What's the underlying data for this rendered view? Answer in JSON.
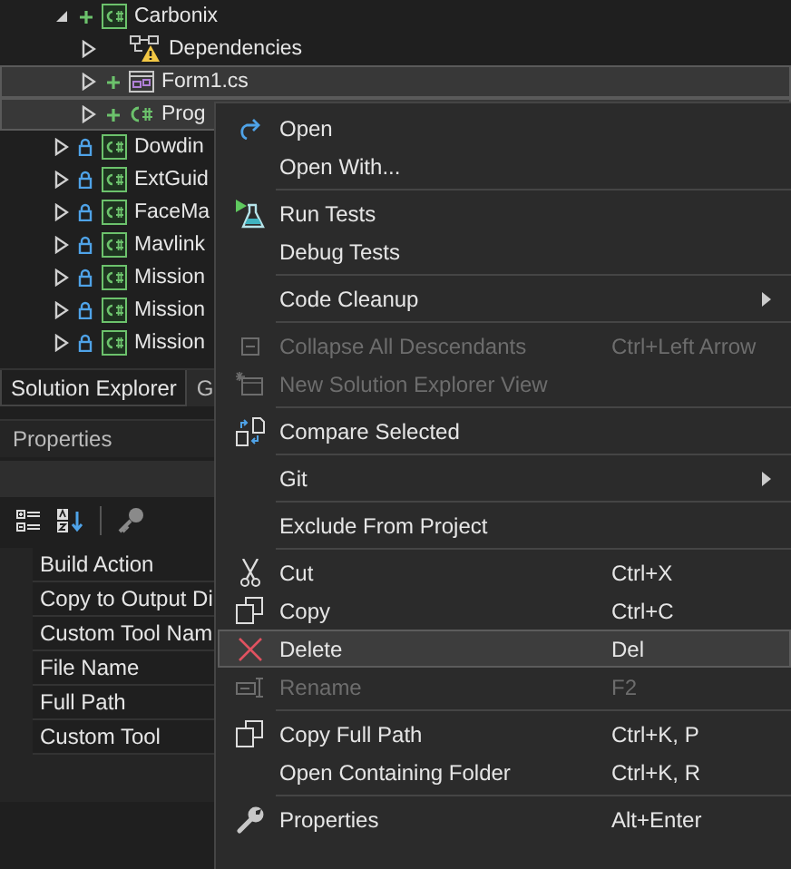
{
  "solution_explorer": {
    "tree": [
      {
        "label": "Carbonix",
        "kind": "project",
        "added": true,
        "locked": false,
        "expanded": true,
        "selected": false,
        "children": [
          {
            "label": "Dependencies",
            "kind": "dependencies",
            "added": false,
            "locked": false,
            "expanded": false,
            "selected": false
          },
          {
            "label": "Form1.cs",
            "kind": "form",
            "added": true,
            "locked": false,
            "expanded": false,
            "selected": true
          },
          {
            "label": "Prog",
            "kind": "csharp",
            "added": true,
            "locked": false,
            "expanded": false,
            "selected": true
          }
        ]
      },
      {
        "label": "Dowdin",
        "kind": "project",
        "added": false,
        "locked": true,
        "expanded": false,
        "selected": false
      },
      {
        "label": "ExtGuid",
        "kind": "project",
        "added": false,
        "locked": true,
        "expanded": false,
        "selected": false
      },
      {
        "label": "FaceMa",
        "kind": "project",
        "added": false,
        "locked": true,
        "expanded": false,
        "selected": false
      },
      {
        "label": "Mavlink",
        "kind": "project",
        "added": false,
        "locked": true,
        "expanded": false,
        "selected": false
      },
      {
        "label": "Mission",
        "kind": "project",
        "added": false,
        "locked": true,
        "expanded": false,
        "selected": false
      },
      {
        "label": "Mission",
        "kind": "project",
        "added": false,
        "locked": true,
        "expanded": false,
        "selected": false
      },
      {
        "label": "Mission",
        "kind": "project",
        "added": false,
        "locked": true,
        "expanded": false,
        "selected": false
      }
    ]
  },
  "tabs": [
    {
      "label": "Solution Explorer",
      "selected": true
    },
    {
      "label": "G",
      "selected": false
    }
  ],
  "properties": {
    "title": "Properties",
    "rows": [
      "Build Action",
      "Copy to Output Di",
      "Custom Tool Nam",
      "File Name",
      "Full Path",
      "Custom Tool"
    ]
  },
  "context_menu": [
    {
      "kind": "item",
      "label": "Open",
      "selected": false,
      "disabled": false,
      "submenu": false
    },
    {
      "kind": "item",
      "label": "Open With...",
      "selected": false,
      "disabled": false,
      "submenu": false
    },
    {
      "kind": "separator"
    },
    {
      "kind": "item",
      "label": "Run Tests",
      "selected": false,
      "disabled": false,
      "submenu": false
    },
    {
      "kind": "item",
      "label": "Debug Tests",
      "selected": false,
      "disabled": false,
      "submenu": false
    },
    {
      "kind": "separator"
    },
    {
      "kind": "item",
      "label": "Code Cleanup",
      "selected": false,
      "disabled": false,
      "submenu": true
    },
    {
      "kind": "separator"
    },
    {
      "kind": "item",
      "label": "Collapse All Descendants",
      "shortcut": "Ctrl+Left Arrow",
      "selected": false,
      "disabled": true,
      "submenu": false
    },
    {
      "kind": "item",
      "label": "New Solution Explorer View",
      "selected": false,
      "disabled": true,
      "submenu": false
    },
    {
      "kind": "separator"
    },
    {
      "kind": "item",
      "label": "Compare Selected",
      "selected": false,
      "disabled": false,
      "submenu": false
    },
    {
      "kind": "separator"
    },
    {
      "kind": "item",
      "label": "Git",
      "selected": false,
      "disabled": false,
      "submenu": true
    },
    {
      "kind": "separator"
    },
    {
      "kind": "item",
      "label": "Exclude From Project",
      "selected": false,
      "disabled": false,
      "submenu": false
    },
    {
      "kind": "separator"
    },
    {
      "kind": "item",
      "label": "Cut",
      "shortcut": "Ctrl+X",
      "selected": false,
      "disabled": false,
      "submenu": false
    },
    {
      "kind": "item",
      "label": "Copy",
      "shortcut": "Ctrl+C",
      "selected": false,
      "disabled": false,
      "submenu": false
    },
    {
      "kind": "item",
      "label": "Delete",
      "shortcut": "Del",
      "selected": true,
      "disabled": false,
      "submenu": false
    },
    {
      "kind": "item",
      "label": "Rename",
      "shortcut": "F2",
      "selected": false,
      "disabled": true,
      "submenu": false
    },
    {
      "kind": "separator"
    },
    {
      "kind": "item",
      "label": "Copy Full Path",
      "shortcut": "Ctrl+K, P",
      "selected": false,
      "disabled": false,
      "submenu": false
    },
    {
      "kind": "item",
      "label": "Open Containing Folder",
      "shortcut": "Ctrl+K, R",
      "selected": false,
      "disabled": false,
      "submenu": false
    },
    {
      "kind": "separator"
    },
    {
      "kind": "item",
      "label": "Properties",
      "shortcut": "Alt+Enter",
      "selected": false,
      "disabled": false,
      "submenu": false
    }
  ]
}
